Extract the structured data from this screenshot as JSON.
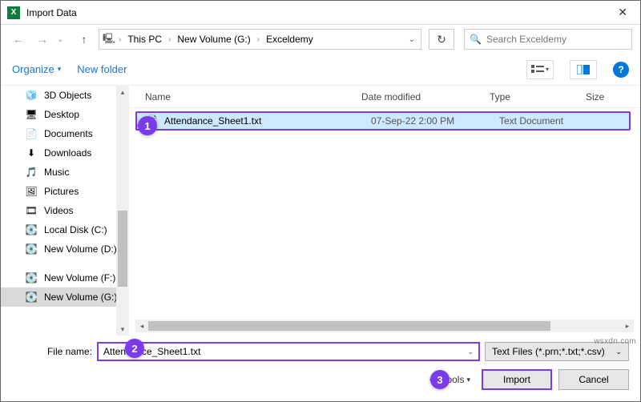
{
  "window": {
    "title": "Import Data",
    "app_glyph": "X"
  },
  "nav": {
    "crumbs": [
      "This PC",
      "New Volume (G:)",
      "Exceldemy"
    ],
    "search_placeholder": "Search Exceldemy"
  },
  "toolbar": {
    "organize": "Organize",
    "newfolder": "New folder"
  },
  "sidebar": {
    "items": [
      {
        "label": "3D Objects",
        "icon": "🧊"
      },
      {
        "label": "Desktop",
        "icon": "🖥"
      },
      {
        "label": "Documents",
        "icon": "📄"
      },
      {
        "label": "Downloads",
        "icon": "⬇"
      },
      {
        "label": "Music",
        "icon": "🎵"
      },
      {
        "label": "Pictures",
        "icon": "🖼"
      },
      {
        "label": "Videos",
        "icon": "🎞"
      },
      {
        "label": "Local Disk (C:)",
        "icon": "💽"
      },
      {
        "label": "New Volume (D:)",
        "icon": "💽"
      },
      {
        "label": "New Volume (F:)",
        "icon": "💽"
      },
      {
        "label": "New Volume (G:)",
        "icon": "💽",
        "selected": true
      }
    ]
  },
  "columns": {
    "name": "Name",
    "date": "Date modified",
    "type": "Type",
    "size": "Size"
  },
  "files": [
    {
      "name": "Attendance_Sheet1.txt",
      "date": "07-Sep-22 2:00 PM",
      "type": "Text Document",
      "selected": true
    }
  ],
  "filebar": {
    "label": "File name:",
    "value": "Attendance_Sheet1.txt",
    "filter": "Text Files (*.prn;*.txt;*.csv)"
  },
  "actions": {
    "tools": "Tools",
    "import": "Import",
    "cancel": "Cancel"
  },
  "callouts": {
    "1": "1",
    "2": "2",
    "3": "3"
  },
  "watermark": "wsxdn.com"
}
